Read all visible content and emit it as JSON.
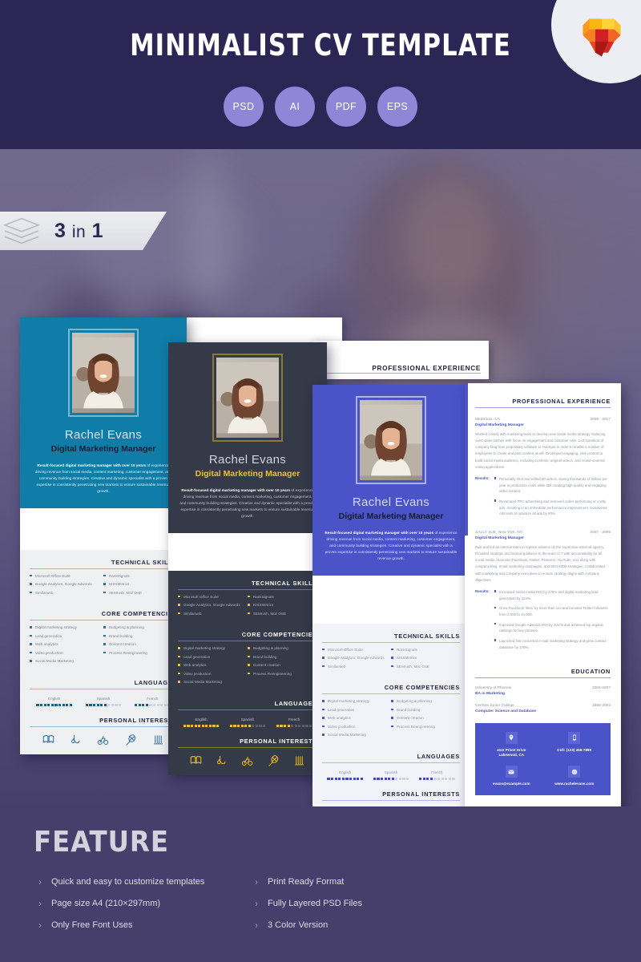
{
  "hero": {
    "title": "MINIMALIST CV TEMPLATE",
    "formats": [
      "PSD",
      "AI",
      "PDF",
      "EPS"
    ],
    "logo_icon": "heart-cube-logo",
    "bg_color": "#2b2653",
    "badge_color": "#8f86d8"
  },
  "ribbon": {
    "count": "3",
    "middle": "in",
    "total": "1",
    "icon": "layers-stack-icon"
  },
  "cv": {
    "name": "Rachel Evans",
    "role": "Digital Marketing Manager",
    "summary_bold": "Result-focused digital marketing manager  with over 10 years",
    "summary_rest": " of experience driving revenue from social media, content marketing, customer engagement, and community building strategies. Creative and dynamic specialist with a proven expertise in consistently penetrating new markets to ensure sustainable revenue growth.",
    "sections": {
      "technical_skills": "TECHNICAL SKILLS",
      "core_competencies": "CORE COMPETENCIES",
      "languages": "LANGUAGES",
      "personal_interests": "PERSONAL INTERESTS",
      "professional_experience": "PROFESSIONAL EXPERIENCE",
      "education": "EDUCATION"
    },
    "technical_skills_left": [
      "Microsoft Office Suite",
      "Google Analytics, Google Adwords",
      "Similarweb"
    ],
    "technical_skills_right": [
      "RankSignals",
      "KISSMetrics",
      "SEMrush, Moz OSE"
    ],
    "core_competencies_left": [
      "Digital marketing strategy",
      "Lead generation",
      "Web analytics",
      "Video production",
      "Social Media Marketing"
    ],
    "core_competencies_right": [
      "Budgeting & planning",
      "Brand building",
      "Content creation",
      "Process Reengineering"
    ],
    "languages": [
      {
        "name": "English",
        "filled": 10,
        "total": 10
      },
      {
        "name": "Spanish",
        "filled": 6,
        "total": 10
      },
      {
        "name": "French",
        "filled": 4,
        "total": 10
      }
    ],
    "interests_icons": [
      "book-icon",
      "saxophone-icon",
      "bicycle-icon",
      "tennis-racket-icon",
      "skiing-icon"
    ]
  },
  "experience": [
    {
      "company": "Medtronix, CA",
      "dates": "2009 - 2017",
      "title": "Digital Marketing Manager",
      "description": "Worked closely with marketing team to develop new social media strategy replacing overt sales pitches with focus on engagement and customer care. Led transition of company blog from proprietary software to HubSpot in order to enable a number of employees to create and post content at will. Developed engaging, viral content to build social media audience, including contests, original videos, and crowd-sourced voting applications.",
      "results_label": "Results:",
      "results": [
        "Personally shot and edited 60 videos, saving thousands of dollars per year in production costs while still creating high-quality and engaging video content.",
        "Revamped PPC advertising and removed under-performing or costly ads, resulting in an immediate performance improvement. Conducted A/B tests to optimize all ads by 80%."
      ]
    },
    {
      "company": "SALLY SUE, New York, NY",
      "dates": "2007 - 2009",
      "title": "Digital Marketing Manager",
      "description": "Built and led an internal team to replace reliance on the expensive external agency. Provided strategic and tactical guidance to the team of 7 with accountability for all social media channels (Facebook, Twitter, Pinterest, YouTube, etc) along with company blog, email marketing campaigns, and SEO/SEM strategies. Collaborated with marketing and company executives to ensure strategy aligns with company objectives.",
      "results_label": "Results:",
      "results": [
        "Increased social media ROI by 275% and digital marketing lead generation by 124%.",
        "Grew Facebook 'likes' by more than 1xx and boosted Twitter followers from 2,000 to 44,000.",
        "Improved Google Adwords ROI by 10x78 and achieved top organic rankings for key phrases.",
        "Launched first concerted e-mail marketing strategy and grew contact database by 178%."
      ]
    }
  ],
  "education": [
    {
      "school": "University of Phoenix",
      "degree": "BA in Marketing",
      "dates": "2003-2007"
    },
    {
      "school": "Cerritos Junior College",
      "degree": "Computer Science and Database",
      "dates": "1999-2003"
    }
  ],
  "contact": [
    {
      "icon": "location-pin-icon",
      "text": "41st Privet Drive\nLakewood, CA"
    },
    {
      "icon": "mobile-phone-icon",
      "text": "Cell: (123) 456-7890"
    },
    {
      "icon": "envelope-icon",
      "text": "evans@example.com"
    },
    {
      "icon": "globe-icon",
      "text": "www.rachelevans.com"
    }
  ],
  "feature": {
    "title": "FEATURE",
    "left": [
      "Quick and easy to customize templates",
      "Page size A4 (210×297mm)",
      "Only Free Font Uses"
    ],
    "right": [
      "Print Ready Format",
      "Fully Layered PSD Files",
      "3 Color Version"
    ]
  },
  "themes": {
    "teal": "#0f7da8",
    "dark": "#343a48",
    "dark_accent": "#f2c018",
    "indigo": "#4a53c8",
    "page_bg": "#463f6b"
  }
}
